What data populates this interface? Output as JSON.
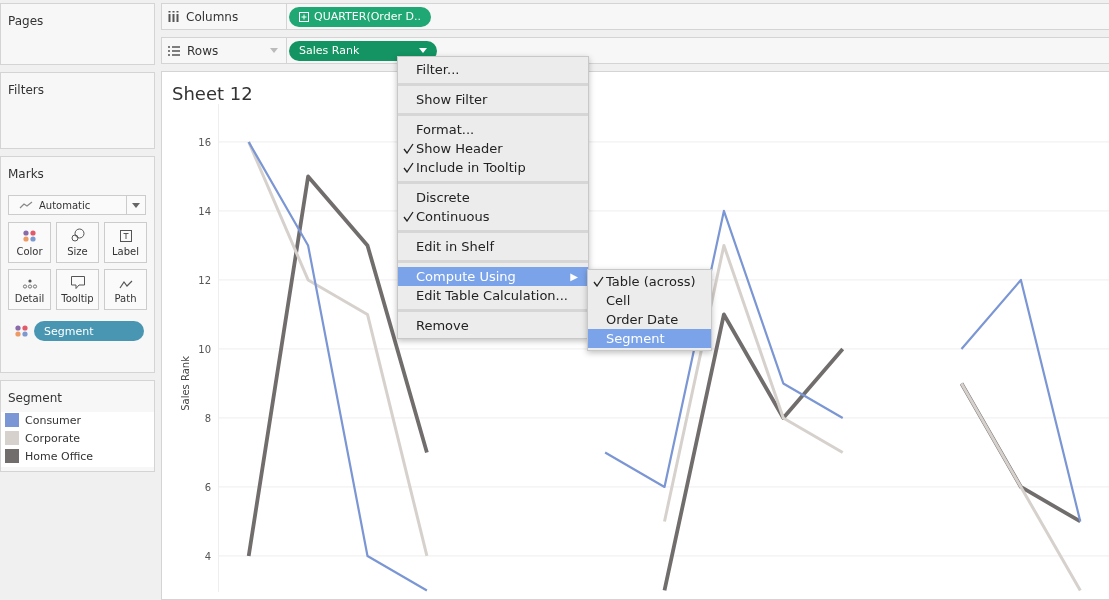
{
  "pages_card": {
    "title": "Pages"
  },
  "filters_card": {
    "title": "Filters"
  },
  "marks_card": {
    "title": "Marks",
    "mark_type": "Automatic",
    "buttons": [
      {
        "label": "Color",
        "kind": "color"
      },
      {
        "label": "Size",
        "kind": "size"
      },
      {
        "label": "Label",
        "kind": "label"
      },
      {
        "label": "Detail",
        "kind": "detail"
      },
      {
        "label": "Tooltip",
        "kind": "tooltip"
      },
      {
        "label": "Path",
        "kind": "path"
      }
    ],
    "pill": {
      "label": "Segment"
    }
  },
  "legend": {
    "title": "Segment"
  },
  "columns_shelf": {
    "label": "Columns",
    "pills": [
      {
        "label": "QUARTER(Order D..",
        "kind": "dimension"
      }
    ]
  },
  "rows_shelf": {
    "label": "Rows",
    "pills": [
      {
        "label": "Sales Rank",
        "kind": "measure"
      }
    ]
  },
  "sheet": {
    "title": "Sheet 12",
    "chart_data": {
      "type": "line",
      "ylabel": "Sales Rank",
      "grid": true,
      "categories": [
        null,
        null,
        null,
        null,
        null,
        null,
        null,
        null,
        null,
        null,
        null,
        null,
        null,
        null,
        null
      ],
      "ylim": [
        3,
        17.1
      ],
      "yticks": [
        4,
        6,
        8,
        10,
        12,
        14,
        16
      ],
      "series": [
        {
          "name": "Consumer",
          "color": "#7b96d4",
          "values": [
            16,
            13,
            4,
            3,
            null,
            null,
            7,
            6,
            14,
            9,
            8,
            null,
            10,
            12,
            5
          ]
        },
        {
          "name": "Corporate",
          "color": "#d6d1cc",
          "values": [
            16,
            12,
            11,
            4,
            null,
            null,
            null,
            5,
            13,
            8,
            7,
            null,
            9,
            6,
            3
          ]
        },
        {
          "name": "Home Office",
          "color": "#716d6d",
          "values": [
            4,
            15,
            13,
            7,
            null,
            null,
            null,
            3,
            11,
            8,
            10,
            null,
            9,
            6,
            5
          ]
        }
      ]
    }
  },
  "context_menu": {
    "groups": [
      [
        {
          "label": "Filter...",
          "checked": false,
          "selected": false
        }
      ],
      [
        {
          "label": "Show Filter",
          "checked": false,
          "selected": false
        }
      ],
      [
        {
          "label": "Format...",
          "checked": false,
          "selected": false
        },
        {
          "label": "Show Header",
          "checked": true,
          "selected": false
        },
        {
          "label": "Include in Tooltip",
          "checked": true,
          "selected": false
        }
      ],
      [
        {
          "label": "Discrete",
          "checked": false,
          "selected": false
        },
        {
          "label": "Continuous",
          "checked": true,
          "selected": false
        }
      ],
      [
        {
          "label": "Edit in Shelf",
          "checked": false,
          "selected": false
        }
      ],
      [
        {
          "label": "Compute Using",
          "checked": false,
          "selected": true,
          "arrow": "▶"
        },
        {
          "label": "Edit Table Calculation...",
          "checked": false,
          "selected": false
        }
      ],
      [
        {
          "label": "Remove",
          "checked": false,
          "selected": false
        }
      ]
    ]
  },
  "submenu": {
    "items": [
      {
        "label": "Table (across)",
        "checked": true,
        "selected": false
      },
      {
        "label": "Cell",
        "checked": false,
        "selected": false
      },
      {
        "label": "Order Date",
        "checked": false,
        "selected": false
      },
      {
        "label": "Segment",
        "checked": false,
        "selected": true
      }
    ]
  }
}
